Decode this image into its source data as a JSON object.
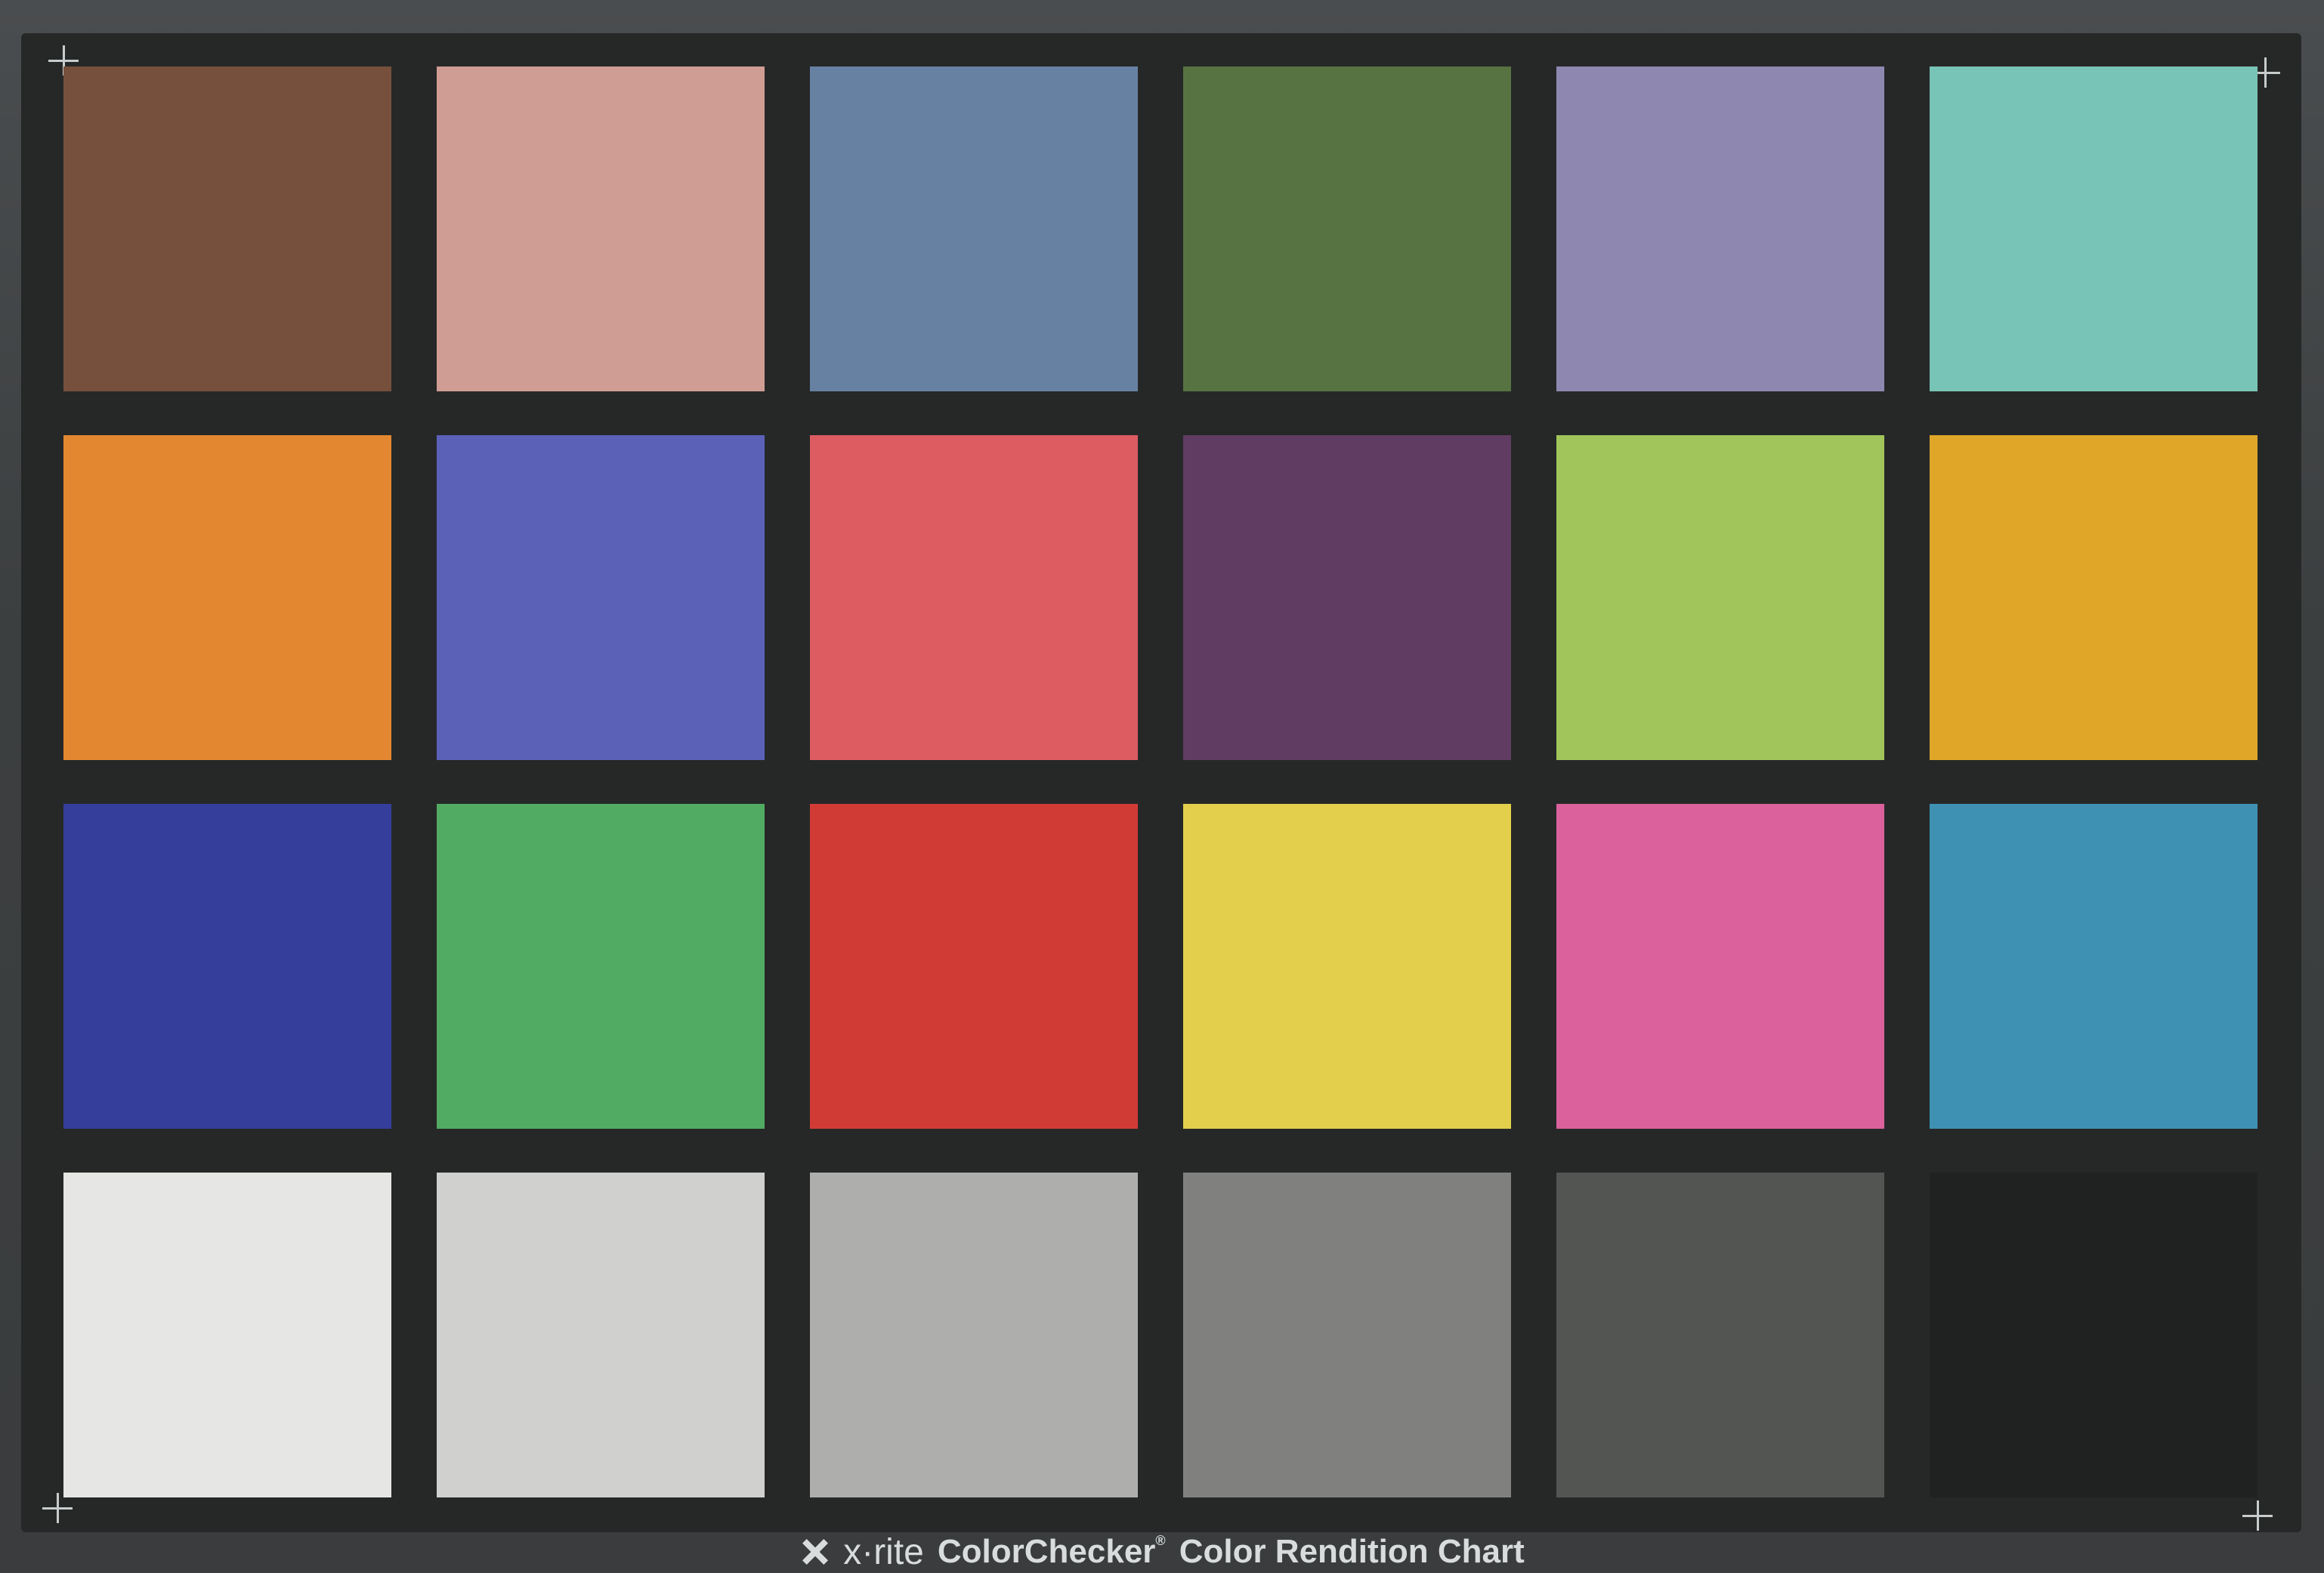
{
  "patches": [
    {
      "color": "#76503c"
    },
    {
      "color": "#d09d94"
    },
    {
      "color": "#6781a2"
    },
    {
      "color": "#577342"
    },
    {
      "color": "#8e88b1"
    },
    {
      "color": "#78c4b6"
    },
    {
      "color": "#e38831"
    },
    {
      "color": "#5c61b8"
    },
    {
      "color": "#dc5c62"
    },
    {
      "color": "#603c62"
    },
    {
      "color": "#a1c55a"
    },
    {
      "color": "#dfa628"
    },
    {
      "color": "#353e9a"
    },
    {
      "color": "#52ab62"
    },
    {
      "color": "#d13b36"
    },
    {
      "color": "#e4cf4c"
    },
    {
      "color": "#da619c"
    },
    {
      "color": "#3f91b4"
    },
    {
      "color": "#e6e6e4"
    },
    {
      "color": "#d0d1cf"
    },
    {
      "color": "#aeafad"
    },
    {
      "color": "#80817e"
    },
    {
      "color": "#535553"
    },
    {
      "color": "#202221"
    }
  ],
  "footer": {
    "logo_icon": "x-rite-logo-icon",
    "brand": "x·rite",
    "product": "ColorChecker",
    "registered": "®",
    "subtitle": "Color Rendition Chart"
  }
}
